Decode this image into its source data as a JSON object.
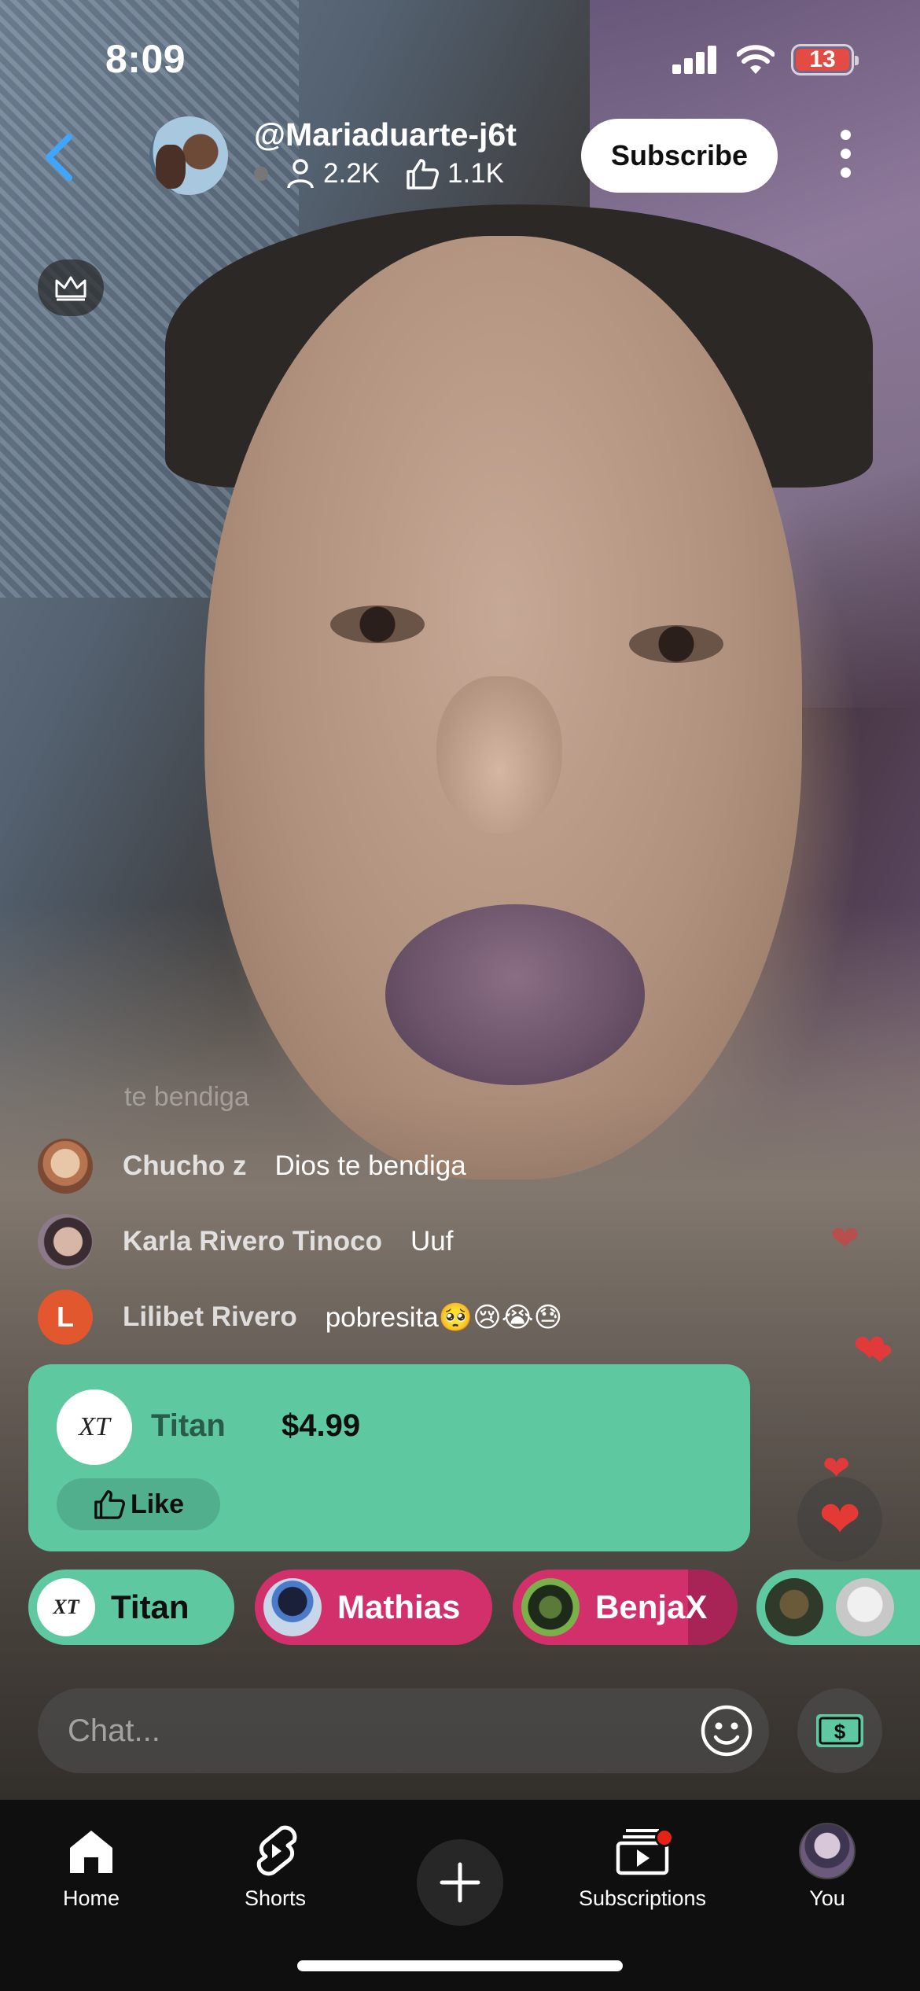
{
  "status_bar": {
    "time": "8:09",
    "battery": "13",
    "battery_color": "#e24c45"
  },
  "header": {
    "channel": "@Mariaduarte-j6t",
    "viewers": "2.2K",
    "likes": "1.1K",
    "subscribe_label": "Subscribe"
  },
  "chat": {
    "faded_text": "te bendiga",
    "messages": [
      {
        "name": "Chucho z",
        "text": "Dios te bendiga",
        "avatar_color": "#c9a58c"
      },
      {
        "name": "Karla Rivero Tinoco",
        "text": "Uuf",
        "avatar_color": "#8c7a8a"
      },
      {
        "name": "Lilibet Rivero",
        "text": "pobresita🥺😢😭😓",
        "avatar_letter": "L",
        "avatar_color": "#e2572e"
      }
    ]
  },
  "super_chat": {
    "logo": "XT",
    "name": "Titan",
    "amount": "$4.99",
    "like_label": "Like",
    "color": "#5ec8a1"
  },
  "pills": [
    {
      "logo": "XT",
      "label": "Titan",
      "color": "#5ec8a1"
    },
    {
      "label": "Mathias",
      "color": "#d2306a"
    },
    {
      "label": "BenjaX",
      "color": "#d2306a"
    },
    {
      "label": "",
      "color": "#5ec8a1"
    }
  ],
  "chat_input": {
    "placeholder": "Chat..."
  },
  "nav": {
    "items": [
      {
        "label": "Home",
        "icon": "home-icon"
      },
      {
        "label": "Shorts",
        "icon": "shorts-icon"
      },
      {
        "label": "",
        "icon": "create-icon"
      },
      {
        "label": "Subscriptions",
        "icon": "subscriptions-icon"
      },
      {
        "label": "You",
        "icon": "avatar"
      }
    ]
  },
  "accent": "#3ea6ff"
}
